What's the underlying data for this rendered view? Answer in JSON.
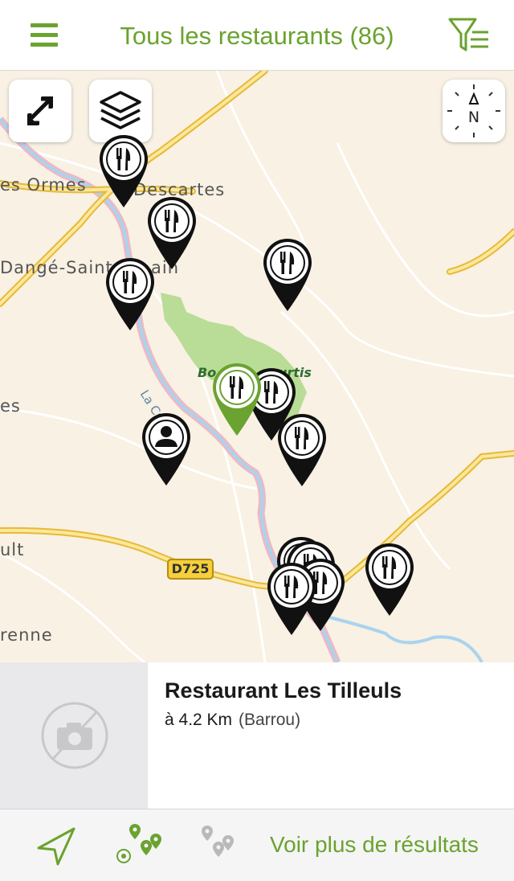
{
  "header": {
    "title": "Tous les restaurants (86)",
    "menu_icon": "hamburger-menu-icon",
    "filter_icon": "filter-funnel-icon",
    "accent_color": "#6aa32f"
  },
  "map": {
    "place_labels": {
      "les_ormes": "es Ormes",
      "descartes": "Descartes",
      "dange": "Dangé-Saint-",
      "dange_end": "ain",
      "left_es": "es",
      "left_ult": "ult",
      "left_enne": "renne"
    },
    "forest_label_a": "Bo",
    "forest_label_b": "urtis",
    "river_label": "La Creuse",
    "road_shield": "D725",
    "controls": {
      "expand_icon": "expand-arrows-icon",
      "layers_icon": "layers-icon",
      "compass_letter": "N"
    },
    "pin_icon": "fork-knife-icon",
    "selected_pin_color": "#6aa32f",
    "pin_color": "#111111"
  },
  "card": {
    "name": "Restaurant Les Tilleuls",
    "distance": "à 4.2 Km",
    "town": "(Barrou)",
    "photo_icon": "no-photo-icon"
  },
  "bottom_bar": {
    "locate_icon": "navigation-arrow-icon",
    "nearby_icon": "nearby-pins-icon",
    "all_icon": "grey-pins-icon",
    "more_results": "Voir plus de résultats"
  }
}
